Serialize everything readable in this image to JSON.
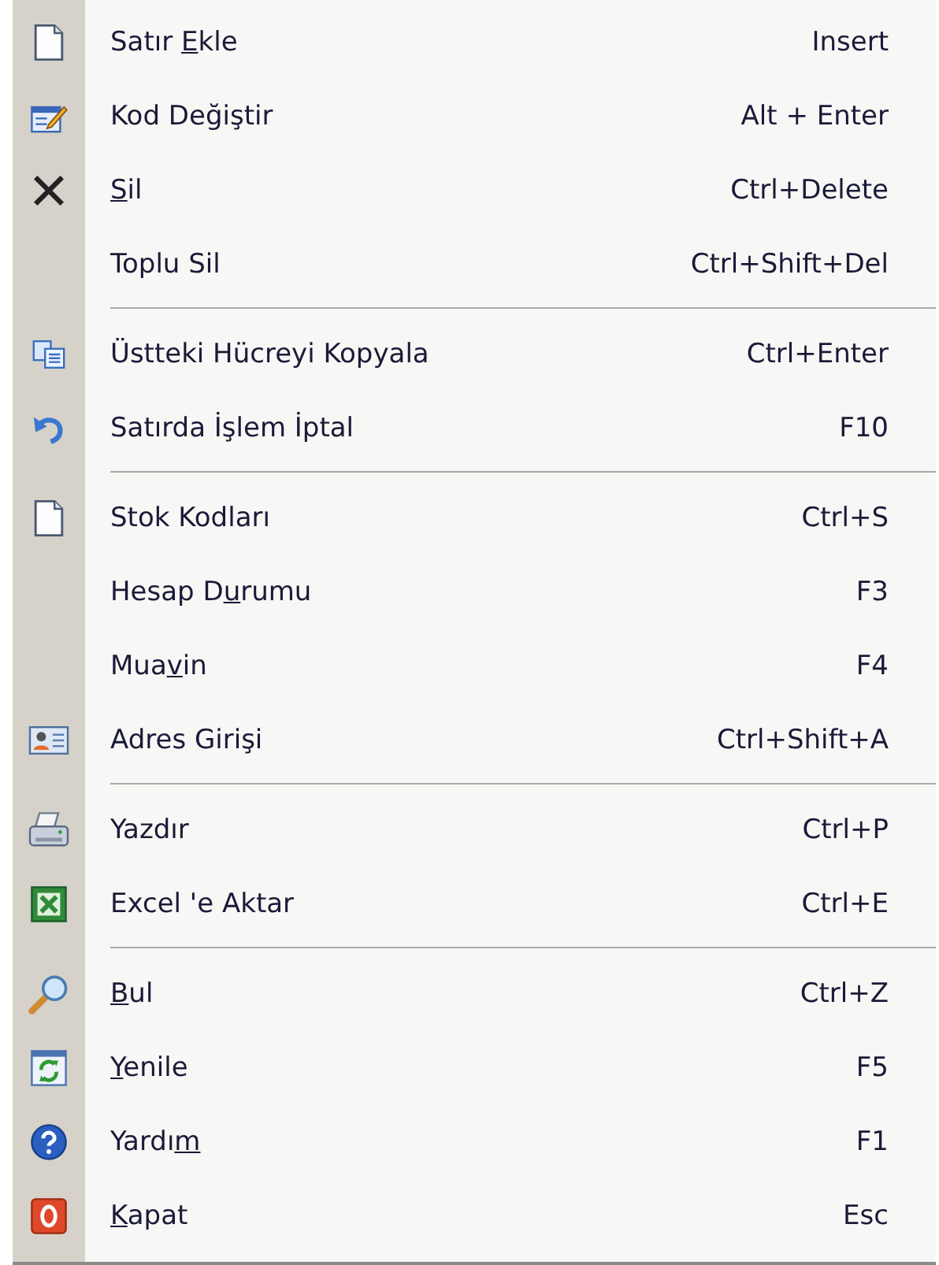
{
  "menu": {
    "sections": [
      {
        "items": [
          {
            "label_start": "Satır ",
            "access_key": "E",
            "label_end": "kle",
            "shortcut": "Insert"
          },
          {
            "label": "Kod Değiştir",
            "shortcut": "Alt + Enter"
          },
          {
            "access_key": "S",
            "label_end": "il",
            "shortcut": "Ctrl+Delete"
          },
          {
            "label": "Toplu Sil",
            "shortcut": "Ctrl+Shift+Del"
          }
        ]
      },
      {
        "items": [
          {
            "label": "Üstteki Hücreyi Kopyala",
            "shortcut": "Ctrl+Enter"
          },
          {
            "label": "Satırda İşlem İptal",
            "shortcut": "F10"
          }
        ]
      },
      {
        "items": [
          {
            "label": "Stok Kodları",
            "shortcut": "Ctrl+S"
          },
          {
            "label_start": "Hesap D",
            "access_key": "u",
            "label_end": "rumu",
            "shortcut": "F3"
          },
          {
            "label_start": "Mua",
            "access_key": "v",
            "label_end": "in",
            "shortcut": "F4"
          },
          {
            "label": "Adres Girişi",
            "shortcut": "Ctrl+Shift+A"
          }
        ]
      },
      {
        "items": [
          {
            "label": "Yazdır",
            "shortcut": "Ctrl+P"
          },
          {
            "label": "Excel 'e Aktar",
            "shortcut": "Ctrl+E"
          }
        ]
      },
      {
        "items": [
          {
            "access_key": "B",
            "label_end": "ul",
            "shortcut": "Ctrl+Z"
          },
          {
            "access_key": "Y",
            "label_end": "enile",
            "shortcut": "F5"
          },
          {
            "label_start": "Yardı",
            "access_key": "m",
            "shortcut": "F1"
          },
          {
            "access_key": "K",
            "label_end": "apat",
            "shortcut": "Esc"
          }
        ]
      }
    ]
  }
}
